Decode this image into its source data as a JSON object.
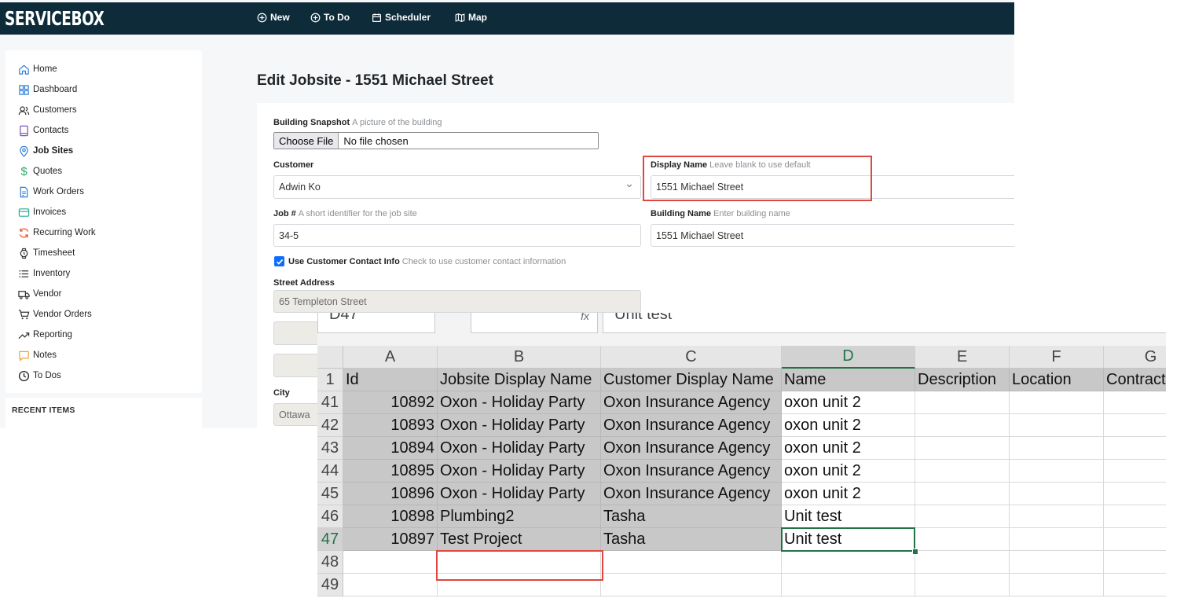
{
  "app": {
    "logo": "SERVICEBOX",
    "nav": [
      {
        "label": "New",
        "icon": "plus-circle-icon"
      },
      {
        "label": "To Do",
        "icon": "plus-circle-icon"
      },
      {
        "label": "Scheduler",
        "icon": "calendar-icon"
      },
      {
        "label": "Map",
        "icon": "map-icon"
      }
    ],
    "sidebar": {
      "items": [
        {
          "label": "Home",
          "icon": "home-icon"
        },
        {
          "label": "Dashboard",
          "icon": "dashboard-icon"
        },
        {
          "label": "Customers",
          "icon": "users-icon"
        },
        {
          "label": "Contacts",
          "icon": "contact-book-icon"
        },
        {
          "label": "Job Sites",
          "icon": "map-pin-icon",
          "active": true
        },
        {
          "label": "Quotes",
          "icon": "dollar-icon"
        },
        {
          "label": "Work Orders",
          "icon": "document-icon"
        },
        {
          "label": "Invoices",
          "icon": "invoice-icon"
        },
        {
          "label": "Recurring Work",
          "icon": "refresh-icon"
        },
        {
          "label": "Timesheet",
          "icon": "watch-icon"
        },
        {
          "label": "Inventory",
          "icon": "list-icon"
        },
        {
          "label": "Vendor",
          "icon": "truck-icon"
        },
        {
          "label": "Vendor Orders",
          "icon": "cart-icon"
        },
        {
          "label": "Reporting",
          "icon": "trending-up-icon"
        },
        {
          "label": "Notes",
          "icon": "note-icon"
        },
        {
          "label": "To Dos",
          "icon": "clock-icon"
        }
      ],
      "recent_title": "RECENT ITEMS"
    },
    "page_title": "Edit Jobsite - 1551 Michael Street",
    "form": {
      "snapshot": {
        "label": "Building Snapshot",
        "hint": "A picture of the building",
        "button": "Choose File",
        "status": "No file chosen"
      },
      "customer": {
        "label": "Customer",
        "value": "Adwin Ko"
      },
      "display_name": {
        "label": "Display Name",
        "hint": "Leave blank to use default",
        "value": "1551 Michael Street"
      },
      "job_number": {
        "label": "Job #",
        "hint": "A short identifier for the job site",
        "value": "34-5"
      },
      "building_name": {
        "label": "Building Name",
        "hint": "Enter building name",
        "value": "1551 Michael Street"
      },
      "use_contact": {
        "label": "Use Customer Contact Info",
        "hint": "Check to use customer contact information",
        "checked": true
      },
      "street": {
        "label": "Street Address",
        "value": "65 Templeton Street"
      },
      "city": {
        "label": "City",
        "value": "Ottawa"
      }
    }
  },
  "excel": {
    "formula_bar": {
      "cell_ref": "D47",
      "value": "Unit test",
      "fx": "fx"
    },
    "columns": [
      "A",
      "B",
      "C",
      "D",
      "E",
      "F",
      "G"
    ],
    "selected_column": "D",
    "header_row": {
      "row": "1",
      "cells": [
        "Id",
        "Jobsite Display Name",
        "Customer Display Name",
        "Name",
        "Description",
        "Location",
        "Contract"
      ]
    },
    "rows": [
      {
        "row": "41",
        "cells": [
          "10892",
          "Oxon - Holiday Party",
          "Oxon Insurance Agency",
          "oxon unit 2",
          "",
          "",
          ""
        ]
      },
      {
        "row": "42",
        "cells": [
          "10893",
          "Oxon - Holiday Party",
          "Oxon Insurance Agency",
          "oxon unit 2",
          "",
          "",
          ""
        ]
      },
      {
        "row": "43",
        "cells": [
          "10894",
          "Oxon - Holiday Party",
          "Oxon Insurance Agency",
          "oxon unit 2",
          "",
          "",
          ""
        ]
      },
      {
        "row": "44",
        "cells": [
          "10895",
          "Oxon - Holiday Party",
          "Oxon Insurance Agency",
          "oxon unit 2",
          "",
          "",
          ""
        ]
      },
      {
        "row": "45",
        "cells": [
          "10896",
          "Oxon - Holiday Party",
          "Oxon Insurance Agency",
          "oxon unit 2",
          "",
          "",
          ""
        ]
      },
      {
        "row": "46",
        "cells": [
          "10898",
          "Plumbing2",
          "Tasha",
          "Unit test",
          "",
          "",
          ""
        ]
      },
      {
        "row": "47",
        "cells": [
          "10897",
          "Test Project",
          "Tasha",
          "Unit test",
          "",
          "",
          ""
        ]
      },
      {
        "row": "48",
        "cells": [
          "",
          "",
          "",
          "",
          "",
          "",
          ""
        ]
      },
      {
        "row": "49",
        "cells": [
          "",
          "",
          "",
          "",
          "",
          "",
          ""
        ]
      }
    ],
    "selected_row": "47"
  },
  "colors": {
    "nav_bg": "#0e2b3a",
    "highlight_red": "#e0473f",
    "excel_green": "#217346",
    "checkbox_blue": "#0d6efd"
  }
}
